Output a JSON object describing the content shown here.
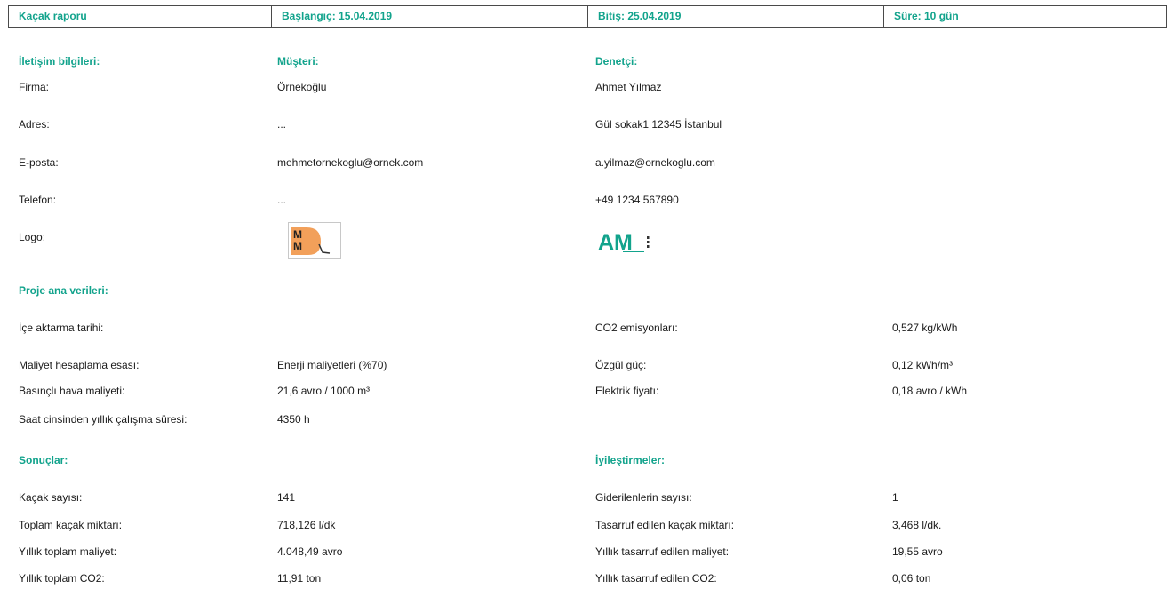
{
  "header": {
    "title": "Kaçak raporu",
    "start": "Başlangıç: 15.04.2019",
    "end": "Bitiş: 25.04.2019",
    "duration": "Süre: 10 gün"
  },
  "contact": {
    "heading": "İletişim bilgileri:",
    "customer_heading": "Müşteri:",
    "auditor_heading": "Denetçi:",
    "rows": [
      {
        "label": "Firma:",
        "customer": "Örnekoğlu",
        "auditor": "Ahmet Yılmaz"
      },
      {
        "label": "Adres:",
        "customer": "...",
        "auditor": "Gül sokak1 12345 İstanbul"
      },
      {
        "label": "E-posta:",
        "customer": "mehmetornekoglu@ornek.com",
        "auditor": "a.yilmaz@ornekoglu.com"
      },
      {
        "label": "Telefon:",
        "customer": "...",
        "auditor": "+49 1234 567890"
      }
    ],
    "logo_label": "Logo:",
    "customer_logo": {
      "letters": "MM",
      "icon": "customer-logo-icon"
    },
    "auditor_logo": {
      "letters": "AM",
      "icon": "auditor-logo-icon"
    }
  },
  "project": {
    "heading": "Proje ana verileri:",
    "left": [
      {
        "label": "İçe aktarma tarihi:",
        "value": ""
      },
      {
        "label": "Maliyet hesaplama esası:",
        "value": "Enerji maliyetleri (%70)"
      },
      {
        "label": "Basınçlı hava maliyeti:",
        "value": "21,6 avro / 1000 m³"
      },
      {
        "label": "Saat cinsinden yıllık çalışma süresi:",
        "value": "4350 h"
      }
    ],
    "right": [
      {
        "label": "CO2 emisyonları:",
        "value": "0,527 kg/kWh"
      },
      {
        "label": "Özgül güç:",
        "value": "0,12 kWh/m³"
      },
      {
        "label": "Elektrik fiyatı:",
        "value": "0,18 avro / kWh"
      }
    ]
  },
  "results": {
    "heading": "Sonuçlar:",
    "rows": [
      {
        "label": "Kaçak sayısı:",
        "value": "141"
      },
      {
        "label": "Toplam kaçak miktarı:",
        "value": "718,126 l/dk"
      },
      {
        "label": "Yıllık toplam maliyet:",
        "value": "4.048,49 avro"
      },
      {
        "label": "Yıllık toplam CO2:",
        "value": "11,91 ton"
      }
    ]
  },
  "improvements": {
    "heading": "İyileştirmeler:",
    "rows": [
      {
        "label": "Giderilenlerin sayısı:",
        "value": "1"
      },
      {
        "label": "Tasarruf edilen kaçak miktarı:",
        "value": "3,468 l/dk."
      },
      {
        "label": "Yıllık tasarruf edilen maliyet:",
        "value": "19,55 avro"
      },
      {
        "label": "Yıllık tasarruf edilen CO2:",
        "value": "0,06 ton"
      }
    ]
  },
  "colors": {
    "accent": "#12a38c",
    "border": "#4a4a4a",
    "logo_orange": "#f2a05a"
  }
}
